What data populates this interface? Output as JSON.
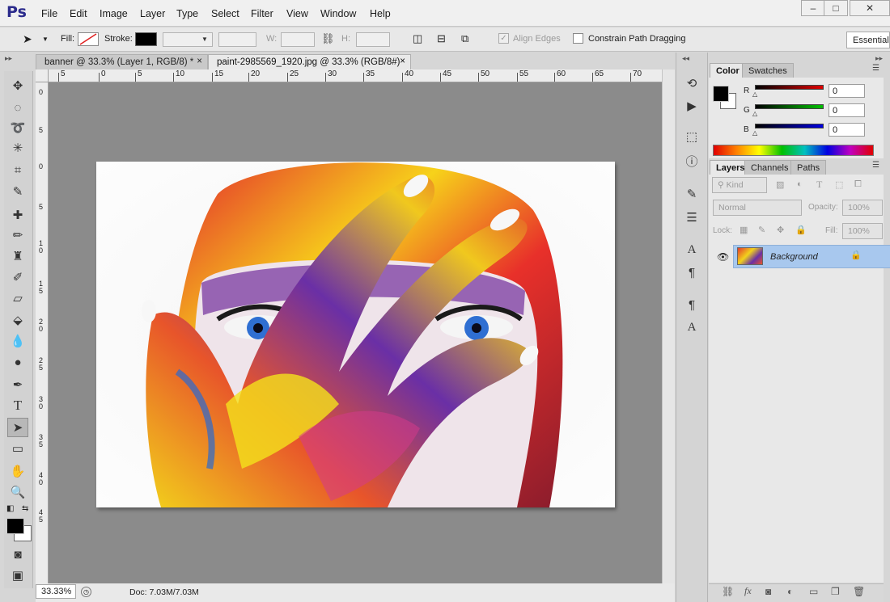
{
  "app": {
    "logo": "Ps"
  },
  "menu": [
    "File",
    "Edit",
    "Image",
    "Layer",
    "Type",
    "Select",
    "Filter",
    "View",
    "Window",
    "Help"
  ],
  "window_controls": {
    "minimize": "‒",
    "maximize": "□",
    "close": "✕"
  },
  "options": {
    "fill_label": "Fill:",
    "stroke_label": "Stroke:",
    "w_label": "W:",
    "h_label": "H:",
    "align_edges": "Align Edges",
    "constrain": "Constrain Path Dragging",
    "workspace": "Essentials"
  },
  "tabs": [
    {
      "label": "banner @ 33.3% (Layer 1, RGB/8) *",
      "close": "×"
    },
    {
      "label": "paint-2985569_1920.jpg @ 33.3% (RGB/8#)",
      "close": "×"
    }
  ],
  "ruler": {
    "top": [
      "5",
      "0",
      "5",
      "10",
      "15",
      "20",
      "25",
      "30",
      "35",
      "40",
      "45",
      "50",
      "55",
      "60",
      "65",
      "70"
    ],
    "left": [
      "0",
      "5",
      "0",
      "5",
      "1 0",
      "1 5",
      "2 0",
      "2 5",
      "3 0",
      "3 5",
      "4 0",
      "4 5"
    ]
  },
  "status": {
    "zoom": "33.33%",
    "doc": "Doc: 7.03M/7.03M"
  },
  "color_panel": {
    "tabs": [
      "Color",
      "Swatches"
    ],
    "channels": [
      {
        "label": "R",
        "value": "0",
        "color": "#d00000"
      },
      {
        "label": "G",
        "value": "0",
        "color": "#00b000"
      },
      {
        "label": "B",
        "value": "0",
        "color": "#0000d0"
      }
    ]
  },
  "layers_panel": {
    "tabs": [
      "Layers",
      "Channels",
      "Paths"
    ],
    "kind": "Kind",
    "blend_mode": "Normal",
    "opacity_label": "Opacity:",
    "opacity": "100%",
    "lock_label": "Lock:",
    "fill_label": "Fill:",
    "fill": "100%",
    "layer_name": "Background"
  },
  "colors": {
    "accent_selection": "#a8c8ee",
    "foreground": "#000000",
    "background": "#ffffff"
  }
}
